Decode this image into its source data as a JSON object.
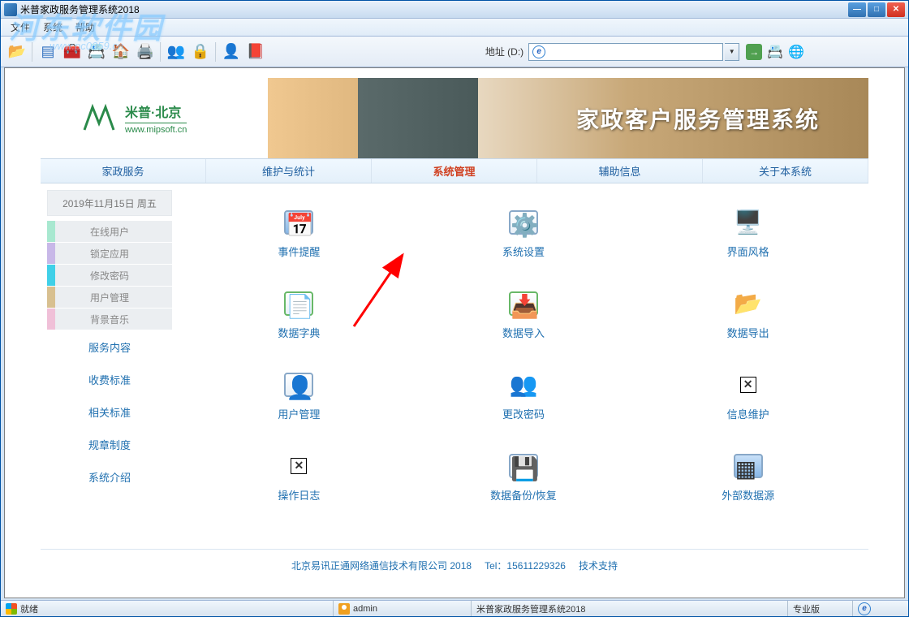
{
  "window": {
    "title": "米普家政服务管理系统2018"
  },
  "menubar": [
    "文件",
    "系统",
    "帮助"
  ],
  "watermark": {
    "main": "河东软件园",
    "sub": "www.pc0359.cn"
  },
  "toolbar": {
    "address_label": "地址 (D:)"
  },
  "logo": {
    "ch": "米普·北京",
    "en": "www.mipsoft.cn"
  },
  "banner_title": "家政客户服务管理系统",
  "navtabs": [
    {
      "label": "家政服务",
      "active": false
    },
    {
      "label": "维护与统计",
      "active": false
    },
    {
      "label": "系统管理",
      "active": true
    },
    {
      "label": "辅助信息",
      "active": false
    },
    {
      "label": "关于本系统",
      "active": false
    }
  ],
  "date_text": "2019年11月15日  周五",
  "sidebar_boxed": [
    {
      "label": "在线用户",
      "cls": "c1"
    },
    {
      "label": "锁定应用",
      "cls": "c2"
    },
    {
      "label": "修改密码",
      "cls": "c3"
    },
    {
      "label": "用户管理",
      "cls": "c4"
    },
    {
      "label": "背景音乐",
      "cls": "c5"
    }
  ],
  "sidebar_links": [
    "服务内容",
    "收费标准",
    "相关标准",
    "规章制度",
    "系统介绍"
  ],
  "grid": [
    {
      "label": "事件提醒",
      "icon": "calendar"
    },
    {
      "label": "系统设置",
      "icon": "settings"
    },
    {
      "label": "界面风格",
      "icon": "monitor"
    },
    {
      "label": "数据字典",
      "icon": "dict"
    },
    {
      "label": "数据导入",
      "icon": "import"
    },
    {
      "label": "数据导出",
      "icon": "export"
    },
    {
      "label": "用户管理",
      "icon": "users"
    },
    {
      "label": "更改密码",
      "icon": "password"
    },
    {
      "label": "信息维护",
      "icon": "missing"
    },
    {
      "label": "操作日志",
      "icon": "missing"
    },
    {
      "label": "数据备份/恢复",
      "icon": "backup"
    },
    {
      "label": "外部数据源",
      "icon": "datasource"
    }
  ],
  "footer": {
    "company": "北京易讯正通网络通信技术有限公司 2018",
    "tel": "Tel：15611229326",
    "support": "技术支持"
  },
  "statusbar": {
    "ready": "就绪",
    "user": "admin",
    "app": "米普家政服务管理系统2018",
    "edition": "专业版"
  }
}
